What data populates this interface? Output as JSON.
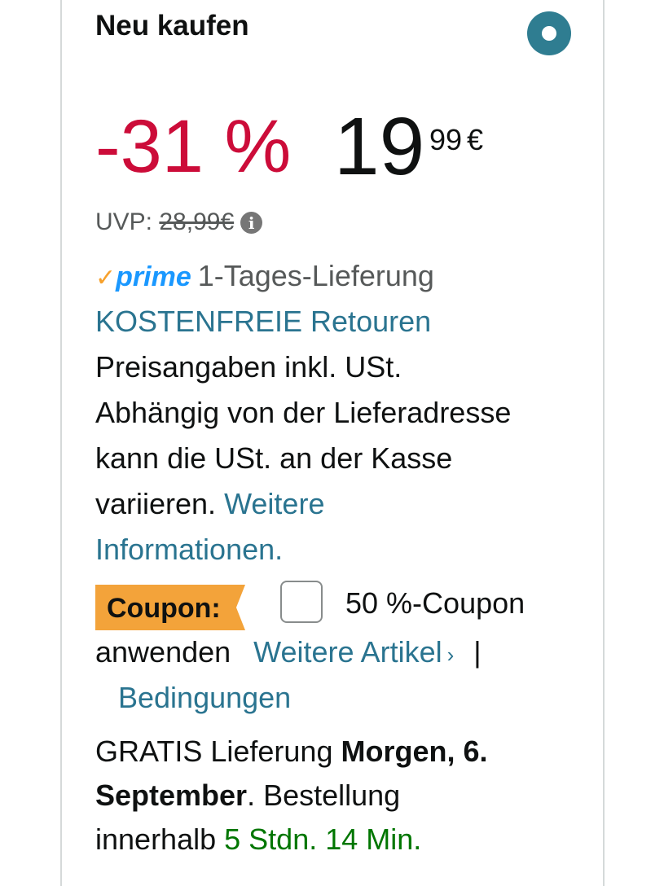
{
  "header": {
    "title": "Neu kaufen"
  },
  "price": {
    "discount": "-31 %",
    "whole": "19",
    "fraction": "99",
    "currency": "€",
    "uvp_label": "UVP:",
    "uvp_value": "28,99€",
    "info_icon": "info-icon"
  },
  "prime": {
    "check": "✓",
    "label": "prime",
    "delivery": "1-Tages-Lieferung"
  },
  "returns": {
    "link": "KOSTENFREIE Retouren"
  },
  "tax_notice": {
    "line1": "Preisangaben inkl. USt.",
    "line2": "Abhängig von der Lieferadresse",
    "line3": "kann die USt. an der Kasse",
    "line4_text": "variieren.",
    "more_info_1": "Weitere",
    "more_info_2": "Informationen."
  },
  "coupon": {
    "badge": "Coupon:",
    "label_part1": "50 %-Coupon",
    "label_part2": "anwenden",
    "more_items": "Weitere Artikel",
    "chevron": "›",
    "separator": "|",
    "terms": "Bedingungen",
    "checked": false
  },
  "delivery": {
    "prefix": "GRATIS Lieferung",
    "date_part1": "Morgen, 6.",
    "date_part2": "September",
    "suffix": ". Bestellung",
    "within": "innerhalb",
    "countdown": "5 Stdn. 14 Min."
  },
  "colors": {
    "discount_red": "#cc0c39",
    "link_teal": "#2a7490",
    "coupon_orange": "#f3a33a",
    "countdown_green": "#007600",
    "prime_blue": "#1a98ff",
    "radio_teal": "#2f7d91"
  }
}
